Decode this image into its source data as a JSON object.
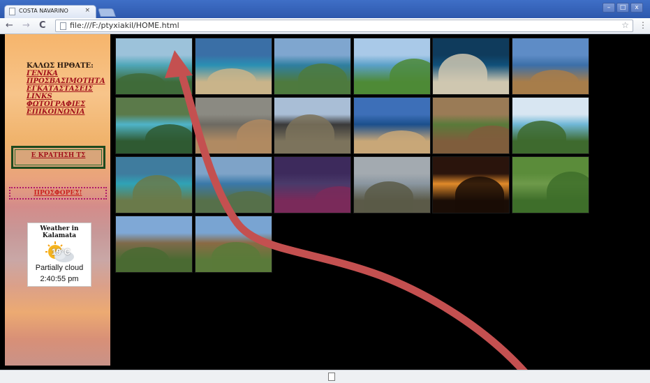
{
  "browser": {
    "tab_title": "COSTA NAVARINO",
    "tab_close": "×",
    "url": "file:///F:/ptyxiakil/HOME.html",
    "back_icon": "back-arrow-icon",
    "forward_icon": "forward-arrow-icon",
    "reload_icon": "reload-icon",
    "star_icon": "bookmark-star-icon",
    "back": "←",
    "forward": "→",
    "reload": "C",
    "star": "☆",
    "min": "–",
    "max": "□",
    "close": "x"
  },
  "sidebar": {
    "welcome": "ΚΑΛΩΣ ΗΡΘΑΤΕ:",
    "menu": [
      {
        "label": "ΓΕΝΙΚΑ"
      },
      {
        "label": "ΠΡΟΣΒΑΣΙΜΟΤΗΤΑ"
      },
      {
        "label": "ΕΓΚΑΤΑΣΤΑΣΕΙΣ"
      },
      {
        "label": "LINKS"
      },
      {
        "label": "ΦΩΤΟΓΡΑΦΙΕΣ"
      },
      {
        "label": "ΕΠΙΚΟΙΝΩΝΙΑ"
      }
    ],
    "reserve_label": "Ε ΚΡΑΤΗΣΗ ΤΣ",
    "offers_label": "ΠΡΟΣΦΟΡΕΣ!",
    "weather": {
      "title_line1": "Weather in",
      "title_line2": "Kalamata",
      "temperature": "19°C",
      "condition": "Partially cloud",
      "time": "2:40:55 pm"
    }
  },
  "gallery": {
    "photos": [
      {
        "name": "bay-aerial",
        "sky": "#9cc2da",
        "land": "#3f6b3a",
        "sea": "#4fa6b8"
      },
      {
        "name": "voidokilia-beach",
        "sky": "#3a6fa6",
        "land": "#c9b48a",
        "sea": "#2a8fb3"
      },
      {
        "name": "lagoon-spit",
        "sky": "#7fa6cf",
        "land": "#4e7a3e",
        "sea": "#2f7fa0"
      },
      {
        "name": "golf-coast",
        "sky": "#a9c9e8",
        "land": "#4e8a36",
        "sea": "#5aa0c8"
      },
      {
        "name": "island-aerial",
        "sky": "#0f3b5c",
        "land": "#cfc7b0",
        "sea": "#10507a"
      },
      {
        "name": "methoni-castle-tower",
        "sky": "#5e8cc6",
        "land": "#a77d4a",
        "sea": "#3c6fa8"
      },
      {
        "name": "waterfall",
        "sky": "#5b7a4a",
        "land": "#2f5a32",
        "sea": "#4fb4c9"
      },
      {
        "name": "castle-colonnade",
        "sky": "#8b8a82",
        "land": "#b08a62",
        "sea": "#6d6a62"
      },
      {
        "name": "ancient-theater",
        "sky": "#a9bed6",
        "land": "#7c735c",
        "sea": "#3a3a3a"
      },
      {
        "name": "sea-rock-islet",
        "sky": "#3d6fb8",
        "land": "#c8a778",
        "sea": "#1b4f8c"
      },
      {
        "name": "stone-archway",
        "sky": "#9a7b56",
        "land": "#7f5d3c",
        "sea": "#5a7a3a"
      },
      {
        "name": "long-beach",
        "sky": "#d8e6f2",
        "land": "#3e6a2e",
        "sea": "#6fb7d6"
      },
      {
        "name": "cove-aerial",
        "sky": "#3f7c9e",
        "land": "#6a7a4a",
        "sea": "#2fa3b6"
      },
      {
        "name": "harbour-town",
        "sky": "#7ea3c8",
        "land": "#56704a",
        "sea": "#3a78a8"
      },
      {
        "name": "purple-field",
        "sky": "#3d2a5c",
        "land": "#7a2a5a",
        "sea": "#4a3a6a"
      },
      {
        "name": "lagoon-reflection",
        "sky": "#a3aab0",
        "land": "#5b5a48",
        "sea": "#8a96a0"
      },
      {
        "name": "sunset-sea",
        "sky": "#2a140c",
        "land": "#1a0d06",
        "sea": "#e08a2a"
      },
      {
        "name": "monastery-hills",
        "sky": "#5b8c3a",
        "land": "#3e6e2a",
        "sea": "#6e9a4a"
      },
      {
        "name": "village-cypress",
        "sky": "#7fa8d6",
        "land": "#4a6a32",
        "sea": "#7f6a4a"
      },
      {
        "name": "byzantine-church",
        "sky": "#79a4d2",
        "land": "#5a7a3a",
        "sea": "#8a6a44"
      }
    ]
  }
}
